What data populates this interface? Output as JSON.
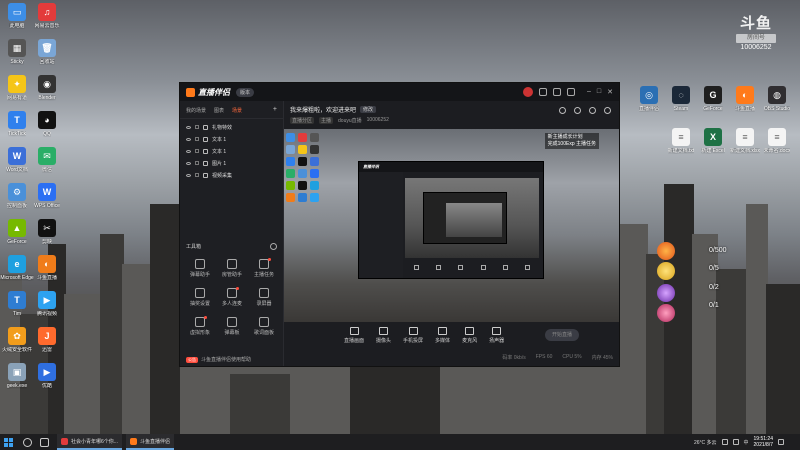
{
  "desktop": {
    "left_icons": [
      {
        "label": "此电脑",
        "color": "#3d8ee6",
        "glyph": "▭"
      },
      {
        "label": "网易云音乐",
        "color": "#e33b3b",
        "glyph": "♫"
      },
      {
        "label": "Sticky",
        "color": "#555555",
        "glyph": "▦"
      },
      {
        "label": "回收站",
        "color": "#7aa6d6",
        "glyph": "🗑"
      },
      {
        "label": "网易有道",
        "color": "#f5c518",
        "glyph": "✦"
      },
      {
        "label": "Blender",
        "color": "#333333",
        "glyph": "◉"
      },
      {
        "label": "TickTick",
        "color": "#2f80ed",
        "glyph": "T"
      },
      {
        "label": "QQ",
        "color": "#111111",
        "glyph": "◕"
      },
      {
        "label": "Word文档",
        "color": "#3b6fd8",
        "glyph": "W"
      },
      {
        "label": "微信",
        "color": "#2aae67",
        "glyph": "✉"
      },
      {
        "label": "控制面板",
        "color": "#4a90d9",
        "glyph": "⚙"
      },
      {
        "label": "WPS Office",
        "color": "#2b6ff3",
        "glyph": "W"
      },
      {
        "label": "GeForce",
        "color": "#76b900",
        "glyph": "▲"
      },
      {
        "label": "剪映",
        "color": "#111111",
        "glyph": "✂"
      },
      {
        "label": "Microsoft Edge",
        "color": "#1fa0e0",
        "glyph": "e"
      },
      {
        "label": "斗鱼直播",
        "color": "#f07c1a",
        "glyph": "◐"
      },
      {
        "label": "Tim",
        "color": "#2e7dd2",
        "glyph": "T"
      },
      {
        "label": "腾讯视频",
        "color": "#2da2f0",
        "glyph": "▶"
      },
      {
        "label": "火绒安全软件",
        "color": "#f29d1c",
        "glyph": "✿"
      },
      {
        "label": "迅雷",
        "color": "#ff6a2d",
        "glyph": "J"
      },
      {
        "label": "geek.exe",
        "color": "#8aa2b8",
        "glyph": "▣"
      },
      {
        "label": "优酷",
        "color": "#2f6fe0",
        "glyph": "▶"
      }
    ],
    "right_icons": [
      {
        "label": "直播伴侣",
        "color": "#2b6fb3",
        "glyph": "◎"
      },
      {
        "label": "Steam",
        "color": "#1b2838",
        "glyph": "◌"
      },
      {
        "label": "GeForce",
        "color": "#1f1f1f",
        "glyph": "G"
      },
      {
        "label": "斗鱼直播",
        "color": "#ff7a1a",
        "glyph": "◐"
      },
      {
        "label": "OBS Studio",
        "color": "#302e31",
        "glyph": "◍"
      },
      {
        "label": "新建文档.txt",
        "color": "#f4f4f4",
        "glyph": "≡"
      },
      {
        "label": "新建 Excel",
        "color": "#1e7145",
        "glyph": "X"
      },
      {
        "label": "新建文档.xlsx",
        "color": "#f4f4f4",
        "glyph": "≡"
      },
      {
        "label": "未命名.docx",
        "color": "#f4f4f4",
        "glyph": "≡"
      }
    ]
  },
  "douyu": {
    "brand": "斗鱼",
    "box": "房间号",
    "room_id": "10006252"
  },
  "app": {
    "title": "直播伴侣",
    "version_pill": "版本",
    "left_tabs": [
      "我的场景",
      "图表",
      "场景"
    ],
    "scenes": [
      "礼物特效",
      "文本 1",
      "文本 1",
      "图片 1",
      "视频采集"
    ],
    "toolbox_title": "工具箱",
    "tools": [
      "弹幕助手",
      "房管助手",
      "主播任务",
      "抽奖设置",
      "多人连麦",
      "录屏器",
      "虚拟形象",
      "弹幕板",
      "歌词面板"
    ],
    "notice_badge": "公告",
    "notice_text": "斗鱼直播伴侣使用帮助",
    "room_title": "我来爆粗啦，欢迎进来吧",
    "room_edit": "修改",
    "room_meta": [
      "直播分区",
      "主播",
      "douyu直播",
      "10006252"
    ],
    "preview_badge_line1": "新主播成长计划",
    "preview_badge_line2": "完成100Exp 主播任务",
    "bottom_buttons": [
      "直播画面",
      "摄像头",
      "手机投屏",
      "多媒体",
      "麦克风",
      "扬声器"
    ],
    "start_button": "开始直播",
    "status": [
      "码率 0kb/s",
      "FPS 60",
      "CPU 5%",
      "内存 45%"
    ]
  },
  "widgets": {
    "counts": [
      "0/500",
      "0/5",
      "0/2",
      "0/1"
    ]
  },
  "taskbar": {
    "apps": [
      {
        "label": "社会小青年哪6个你...",
        "color": "#e33b3b"
      },
      {
        "label": "斗鱼直播伴侣",
        "color": "#ff7a1a"
      }
    ],
    "weather": "26°C 多云",
    "lang": "中",
    "time": "19:51:24",
    "date": "2021/8/7"
  }
}
